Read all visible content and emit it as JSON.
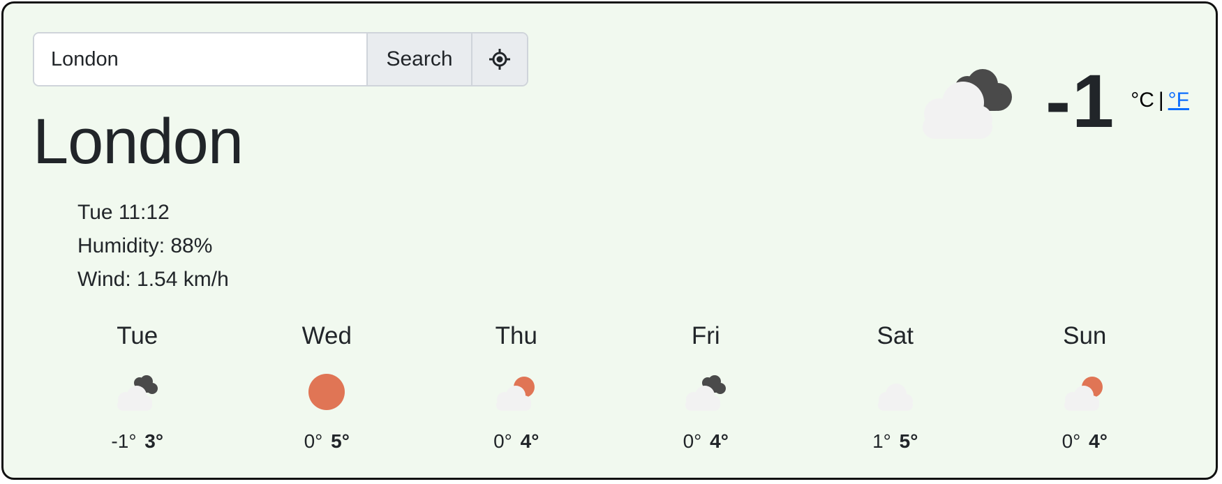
{
  "search": {
    "value": "London",
    "button_label": "Search"
  },
  "current": {
    "city": "London",
    "time": "Tue 11:12",
    "humidity": "Humidity: 88%",
    "wind": "Wind: 1.54 km/h",
    "temperature": "-1",
    "icon": "cloud-dark-cloud-icon",
    "units": {
      "celsius": "°C",
      "separator": "|",
      "fahrenheit": "°F",
      "active": "°C"
    }
  },
  "forecast": [
    {
      "day": "Tue",
      "min": "-1°",
      "max": "3°",
      "icon": "cloud-dark-cloud-icon"
    },
    {
      "day": "Wed",
      "min": "0°",
      "max": "5°",
      "icon": "sun-icon"
    },
    {
      "day": "Thu",
      "min": "0°",
      "max": "4°",
      "icon": "cloud-sun-icon"
    },
    {
      "day": "Fri",
      "min": "0°",
      "max": "4°",
      "icon": "cloud-dark-cloud-icon"
    },
    {
      "day": "Sat",
      "min": "1°",
      "max": "5°",
      "icon": "cloud-icon"
    },
    {
      "day": "Sun",
      "min": "0°",
      "max": "4°",
      "icon": "cloud-sun-icon"
    }
  ],
  "colors": {
    "background": "#f1f9ef",
    "sun": "#e07555",
    "dark_cloud": "#4a4a4a",
    "light_cloud": "#f2f2f2",
    "link": "#0d6efd"
  }
}
